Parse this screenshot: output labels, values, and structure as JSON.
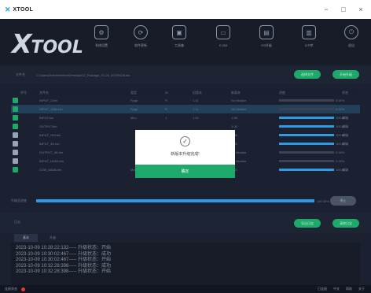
{
  "window": {
    "title": "XTOOL",
    "logo_glyph": "✕",
    "minimize": "−",
    "maximize": "□",
    "close": "×"
  },
  "nav": {
    "brand": "TOOL",
    "brand_x": "X",
    "items": [
      {
        "label": "系统设置",
        "icon": "gear-icon",
        "glyph": "⚙"
      },
      {
        "label": "软件更新",
        "icon": "refresh-icon",
        "glyph": "⟳"
      },
      {
        "label": "工具箱",
        "icon": "toolbox-icon",
        "glyph": "▣"
      },
      {
        "label": "H.264",
        "icon": "monitor-icon",
        "glyph": "▭"
      },
      {
        "label": "OS升级",
        "icon": "chip-icon",
        "glyph": "▤"
      },
      {
        "label": "ICP库",
        "icon": "database-icon",
        "glyph": "▥"
      },
      {
        "label": "退出",
        "icon": "power-icon",
        "glyph": "⏻"
      }
    ]
  },
  "path": {
    "label": "文件名",
    "value": "C:/Users/Administrator/Desktop/G2_Package_V1.26_20230428.bin",
    "btn_browse": "选择文件",
    "btn_start": "开始升级"
  },
  "table": {
    "headers": [
      "序号",
      "文件名",
      "类型",
      "ID",
      "旧版本",
      "新版本",
      "进度",
      "状态"
    ],
    "rows": [
      {
        "checked": true,
        "name": "INPUT_1.bin",
        "type": "Fpga",
        "id": "R",
        "old": "1.11",
        "new": "No Module",
        "progress": 0,
        "pct": "0.00%",
        "status": "",
        "highlight": false
      },
      {
        "checked": true,
        "name": "INPUT_1084.bin",
        "type": "Fpga",
        "id": "R",
        "old": "1.11",
        "new": "No Module",
        "progress": 0,
        "pct": "0.00%",
        "status": "",
        "highlight": true
      },
      {
        "checked": true,
        "name": "INPUT.bin",
        "type": "Mcu",
        "id": "1",
        "old": "1.02",
        "new": "1.08",
        "progress": 100,
        "pct": "100.00%",
        "status": "成功",
        "highlight": false
      },
      {
        "checked": true,
        "name": "OUTPUT.bin",
        "type": "",
        "id": "",
        "old": "",
        "new": "1.05",
        "progress": 100,
        "pct": "100.00%",
        "status": "成功",
        "highlight": false
      },
      {
        "checked": false,
        "name": "INPUT_SDI.bin",
        "type": "",
        "id": "",
        "old": "",
        "new": "1.06",
        "progress": 100,
        "pct": "100.00%",
        "status": "成功",
        "highlight": false
      },
      {
        "checked": false,
        "name": "INPUT_4K.bin",
        "type": "",
        "id": "",
        "old": "",
        "new": "1.06",
        "progress": 100,
        "pct": "100.00%",
        "status": "成功",
        "highlight": false
      },
      {
        "checked": false,
        "name": "OUTPUT_4K.bin",
        "type": "",
        "id": "",
        "old": "",
        "new": "No Module",
        "progress": 0,
        "pct": "0.00%",
        "status": "",
        "highlight": false
      },
      {
        "checked": false,
        "name": "INPUT_HDMI.bin",
        "type": "",
        "id": "",
        "old": "",
        "new": "No Module",
        "progress": 0,
        "pct": "0.00%",
        "status": "",
        "highlight": false
      },
      {
        "checked": true,
        "name": "COM_MAIN.bin",
        "type": "Mcu",
        "id": "P",
        "old": "1.30",
        "new": "1.40",
        "progress": 100,
        "pct": "100.00%",
        "status": "成功",
        "highlight": false
      }
    ]
  },
  "overall": {
    "label": "升级总进度",
    "progress": 100,
    "pct": "100.00%",
    "btn": "停止"
  },
  "section2": {
    "label": "日志",
    "btn_a": "导出日志",
    "btn_b": "清除日志"
  },
  "tabs": [
    "基本",
    "升级"
  ],
  "log": [
    "2023-10-09 10:28:22:132----- 升级状态：开始",
    "2023-10-09 10:30:02:467----- 升级状态：成功",
    "2023-10-09 10:30:02:467----- 升级状态：开始",
    "2023-10-09 10:32:28:398----- 升级状态：成功",
    "2023-10-09 10:32:28:398----- 升级状态：开始"
  ],
  "status": {
    "label": "连接状态",
    "right1": "已连接",
    "right2": "中文",
    "right3": "帮助",
    "right4": "关于"
  },
  "dialog": {
    "message": "新版本升级完成!",
    "confirm": "确定",
    "icon_glyph": "✓"
  }
}
